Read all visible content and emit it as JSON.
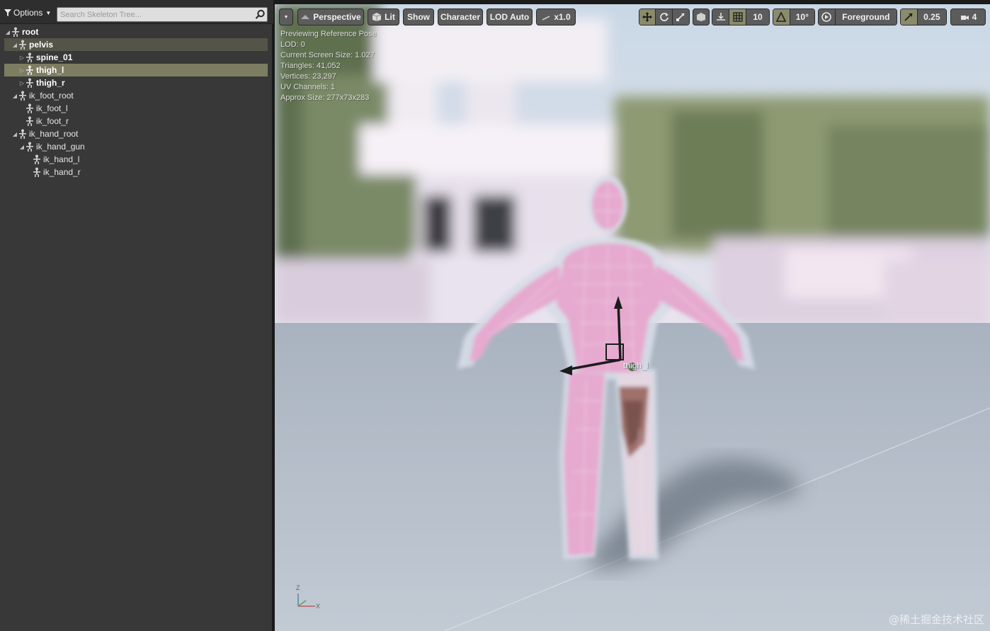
{
  "skeleton_tree": {
    "options_label": "Options",
    "search_placeholder": "Search Skeleton Tree...",
    "bones": [
      {
        "name": "root",
        "bold": true,
        "expanded": true
      },
      {
        "name": "pelvis",
        "bold": true,
        "expanded": true
      },
      {
        "name": "spine_01",
        "bold": true,
        "expanded": false
      },
      {
        "name": "thigh_l",
        "bold": true,
        "expanded": false,
        "selected": true
      },
      {
        "name": "thigh_r",
        "bold": true,
        "expanded": false
      },
      {
        "name": "ik_foot_root",
        "bold": false,
        "expanded": true
      },
      {
        "name": "ik_foot_l",
        "bold": false
      },
      {
        "name": "ik_foot_r",
        "bold": false
      },
      {
        "name": "ik_hand_root",
        "bold": false,
        "expanded": true
      },
      {
        "name": "ik_hand_gun",
        "bold": false,
        "expanded": true
      },
      {
        "name": "ik_hand_l",
        "bold": false
      },
      {
        "name": "ik_hand_r",
        "bold": false
      }
    ]
  },
  "viewport": {
    "toolbar": {
      "perspective_label": "Perspective",
      "lit_label": "Lit",
      "show_label": "Show",
      "character_label": "Character",
      "lod_label": "LOD Auto",
      "playback_speed_label": "x1.0",
      "grid_snap_value": "10",
      "rotation_snap_value": "10°",
      "layer_label": "Foreground",
      "scale_snap_value": "0.25",
      "camera_speed_value": "4"
    },
    "stats": {
      "line1": "Previewing Reference Pose",
      "line2": "LOD: 0",
      "line3": "Current Screen Size: 1.027",
      "line4": "Triangles: 41,052",
      "line5": "Vertices: 23,297",
      "line6": "UV Channels: 1",
      "line7": "Approx Size: 277x73x283"
    },
    "selected_bone_label": "thigh_l",
    "axis_labels": {
      "z": "Z",
      "x": "X"
    },
    "watermark": "@稀土掘金技术社区"
  },
  "colors": {
    "panel_bg": "#383838",
    "selection": "#7d7d62",
    "toolbar_button": "#5c5c5c",
    "active_toggle": "#8a8a6c",
    "floor": "#b3bcc7",
    "mesh": "#e6a9cf"
  }
}
